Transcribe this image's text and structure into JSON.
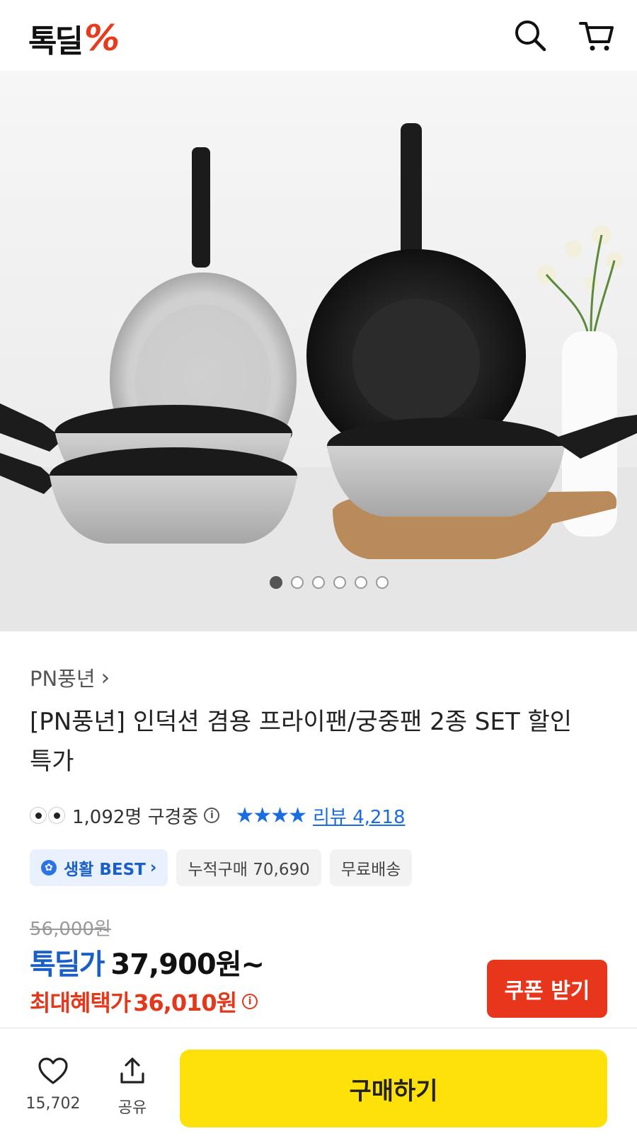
{
  "header": {
    "logo_text": "톡딜",
    "logo_mark": "%",
    "search_icon": "search-icon",
    "cart_icon": "cart-icon"
  },
  "gallery": {
    "image_label": "product-photo-frying-pans",
    "total_slides": 6,
    "active_slide": 1
  },
  "product": {
    "brand": "PN풍년",
    "brand_chevron": "›",
    "title": "[PN풍년] 인덕션 겸용 프라이팬/궁중팬 2종 SET 할인 특가",
    "viewers": "1,092명 구경중",
    "stars": "★★★★",
    "review_label": "리뷰 4,218"
  },
  "chips": {
    "best": "생활 BEST",
    "best_chevron": "›",
    "cumulative": "누적구매 70,690",
    "free_shipping": "무료배송"
  },
  "pricing": {
    "original": "56,000원",
    "deal_label": "톡딜가",
    "deal_price": "37,900원~",
    "max_label": "최대혜택가",
    "max_price": "36,010원",
    "coupon_button": "쿠폰 받기"
  },
  "bottom_bar": {
    "like_count": "15,702",
    "share_label": "공유",
    "buy_button": "구매하기"
  },
  "colors": {
    "brand_blue": "#1a5fc8",
    "accent_red": "#e8361d",
    "buy_yellow": "#ffe10a"
  }
}
